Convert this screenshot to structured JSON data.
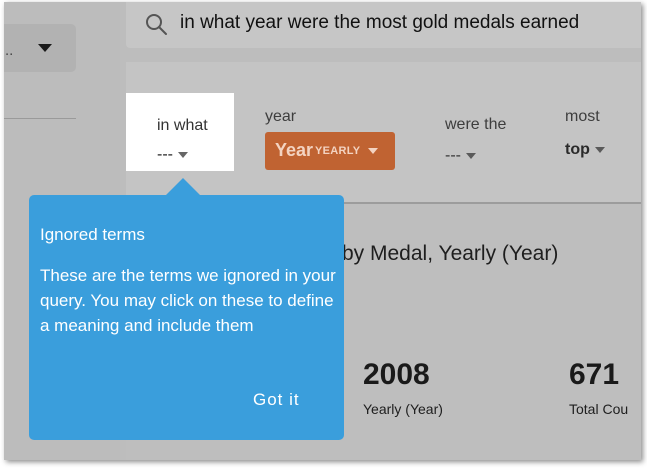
{
  "search": {
    "query": "in what year were the most gold medals earned"
  },
  "sidebar": {
    "selector_text": ".."
  },
  "tokens": [
    {
      "label": "in what",
      "value": "---"
    },
    {
      "label": "year",
      "value": "Year",
      "sub": "YEARLY"
    },
    {
      "label": "were the",
      "value": "---"
    },
    {
      "label": "most",
      "value": "top"
    }
  ],
  "chart": {
    "title": "by Medal, Yearly (Year)",
    "metrics": [
      {
        "value": "2008",
        "label": "Yearly (Year)"
      },
      {
        "value": "671",
        "label": "Total Cou"
      }
    ]
  },
  "tooltip": {
    "title": "Ignored terms",
    "body": "These are the terms we ignored in your query. You may click on these to define a meaning and include them",
    "button": "Got it"
  },
  "colors": {
    "tooltip_bg": "#3a9edc",
    "year_chip_bg": "#c06332",
    "highlight_bg": "#ffffff"
  }
}
